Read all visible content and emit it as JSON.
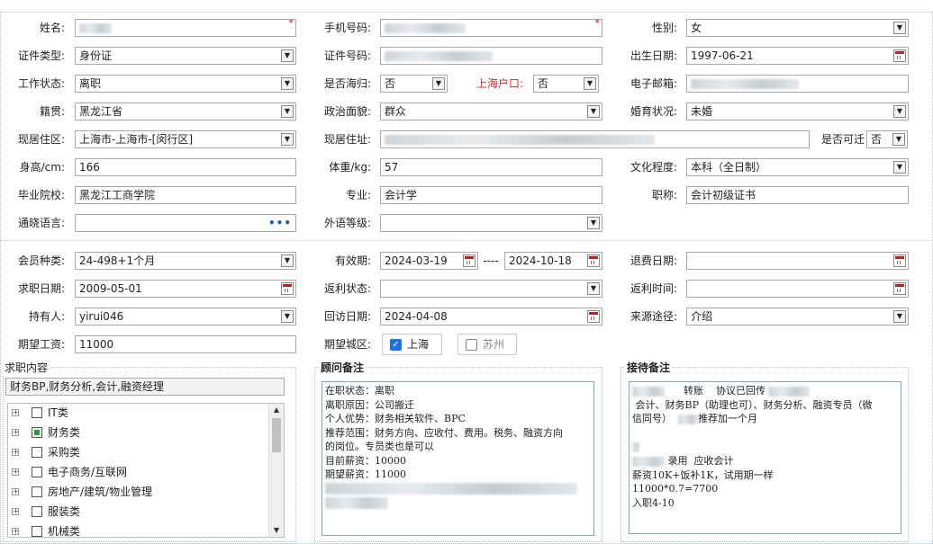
{
  "form": {
    "name_label": "姓名:",
    "phone_label": "手机号码:",
    "gender_label": "性别:",
    "gender_value": "女",
    "id_type_label": "证件类型:",
    "id_type_value": "身份证",
    "id_no_label": "证件号码:",
    "birth_label": "出生日期:",
    "birth_value": "1997-06-21",
    "work_status_label": "工作状态:",
    "work_status_value": "离职",
    "returnee_label": "是否海归:",
    "returnee_value": "否",
    "shanghai_hukou_label": "上海户口:",
    "shanghai_hukou_value": "否",
    "email_label": "电子邮箱:",
    "native_label": "籍贯:",
    "native_value": "黑龙江省",
    "political_label": "政治面貌:",
    "political_value": "群众",
    "marital_label": "婚育状况:",
    "marital_value": "未婚",
    "residence_area_label": "现居住区:",
    "residence_area_value": "上海市-上海市-[闵行区]",
    "residence_addr_label": "现居住址:",
    "relocate_label": "是否可迁",
    "relocate_value": "否",
    "height_label": "身高/cm:",
    "height_value": "166",
    "weight_label": "体重/kg:",
    "weight_value": "57",
    "education_label": "文化程度:",
    "education_value": "本科（全日制）",
    "school_label": "毕业院校:",
    "school_value": "黑龙江工商学院",
    "major_label": "专业:",
    "major_value": "会计学",
    "title_label": "职称:",
    "title_value": "会计初级证书",
    "language_label": "通晓语言:",
    "foreign_level_label": "外语等级:"
  },
  "member": {
    "type_label": "会员种类:",
    "type_value": "24-498+1个月",
    "valid_label": "有效期:",
    "valid_from": "2024-03-19",
    "valid_sep": "----",
    "valid_to": "2024-10-18",
    "refund_date_label": "退费日期:",
    "job_date_label": "求职日期:",
    "job_date_value": "2009-05-01",
    "rebate_status_label": "返利状态:",
    "rebate_time_label": "返利时间:",
    "holder_label": "持有人:",
    "holder_value": "yirui046",
    "visit_date_label": "回访日期:",
    "visit_date_value": "2024-04-08",
    "source_label": "来源途径:",
    "source_value": "介绍",
    "salary_label": "期望工资:",
    "salary_value": "11000",
    "city_label": "期望城区:",
    "city_options": [
      "上海",
      "苏州"
    ]
  },
  "job_panel": {
    "title": "求职内容",
    "summary": "财务BP,财务分析,会计,融资经理",
    "tree_items": [
      "IT类",
      "财务类",
      "采购类",
      "电子商务/互联网",
      "房地产/建筑/物业管理",
      "服装类",
      "机械类"
    ],
    "checked_index": 1
  },
  "advisor_panel": {
    "title": "顾问备注",
    "lines": [
      "在职状态：离职",
      "离职原因：公司搬迁",
      "个人优势：财务相关软件、BPC",
      "推荐范围：财务方向、应收付、费用。税务、融资方向",
      "的岗位。专员类也是可以",
      "目前薪资：10000",
      "期望薪资：11000"
    ]
  },
  "reception_panel": {
    "title": "接待备注",
    "line1": "转账    协议已回传",
    "line2": " 会计、财务BP（助理也可）、财务分析、融资专员（微",
    "line3a": "信同号）",
    "line3b": "推荐加一个月",
    "line4": "录用  应收会计",
    "line5": "薪资10K+饭补1K，试用期一样",
    "line6": "11000*0.7=7700",
    "line7": "入职4-10"
  },
  "icons": {
    "dropdown": "chevron-down-icon",
    "calendar": "calendar-icon",
    "more": "ellipsis-icon"
  }
}
